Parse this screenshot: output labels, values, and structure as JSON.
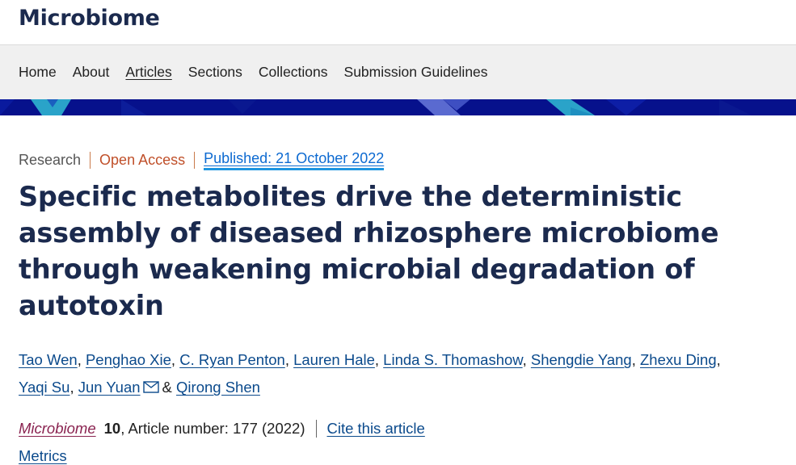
{
  "header": {
    "brand": "Microbiome"
  },
  "nav": {
    "items": [
      "Home",
      "About",
      "Articles",
      "Sections",
      "Collections",
      "Submission Guidelines"
    ],
    "active": "Articles"
  },
  "colors": {
    "brand_navy": "#1b2a4e",
    "banner_navy": "#06118c",
    "banner_accent": "#2aa3c9",
    "link_blue": "#0b4a8c",
    "open_access": "#c0502a",
    "journal": "#8a2350"
  },
  "article": {
    "type": "Research",
    "access": "Open Access",
    "published": "Published: 21 October 2022",
    "title": "Specific metabolites drive the deterministic assembly of diseased rhizosphere microbiome through weakening microbial degradation of autotoxin",
    "authors": [
      "Tao Wen",
      "Penghao Xie",
      "C. Ryan Penton",
      "Lauren Hale",
      "Linda S. Thomashow",
      "Shengdie Yang",
      "Zhexu Ding",
      "Yaqi Su",
      "Jun Yuan",
      "Qirong Shen"
    ],
    "corresponding_icon": "envelope-icon",
    "journal": "Microbiome",
    "volume": "10",
    "article_number": ", Article number: 177 (2022)",
    "cite_label": "Cite this article",
    "metrics_label": "Metrics"
  }
}
